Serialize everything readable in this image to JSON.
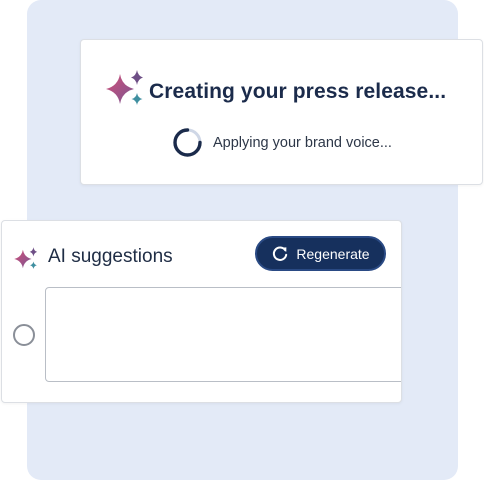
{
  "status": {
    "title": "Creating your press release...",
    "message": "Applying your brand voice...",
    "sparkle_icon": "sparkle-icon",
    "spinner_icon": "loading-spinner-icon"
  },
  "suggestions": {
    "title": "AI suggestions",
    "regenerate_label": "Regenerate",
    "regenerate_icon": "refresh-icon",
    "items": [
      {
        "text": "",
        "selected": false
      }
    ]
  },
  "colors": {
    "backdrop": "#e3eaf7",
    "brand_navy": "#16305d",
    "title_text": "#1b2b4b",
    "sparkle_pink": "#c4507b",
    "sparkle_purple": "#6e4f86",
    "sparkle_teal": "#3f8fa0"
  }
}
